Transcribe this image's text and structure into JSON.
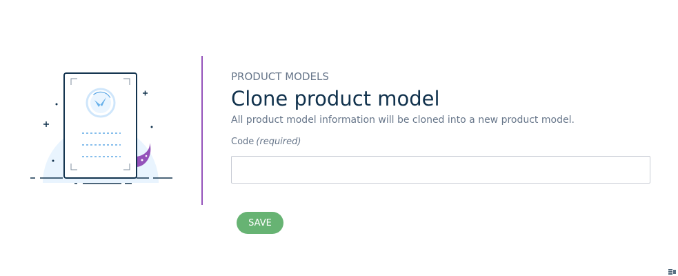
{
  "modal": {
    "section_title": "PRODUCT MODELS",
    "title": "Clone product model",
    "subtitle": "All product model information will be cloned into a new product model.",
    "code_field": {
      "label": "Code",
      "required_text": "(required)",
      "value": "",
      "placeholder": ""
    },
    "save_label": "SAVE"
  },
  "icons": {
    "illustration": "product-model-illustration",
    "corner": "corner-icon"
  },
  "colors": {
    "accent": "#9452ba",
    "save_button": "#67b373",
    "title_text": "#11324d",
    "secondary_text": "#67768a",
    "input_border": "#c7cbd4"
  }
}
